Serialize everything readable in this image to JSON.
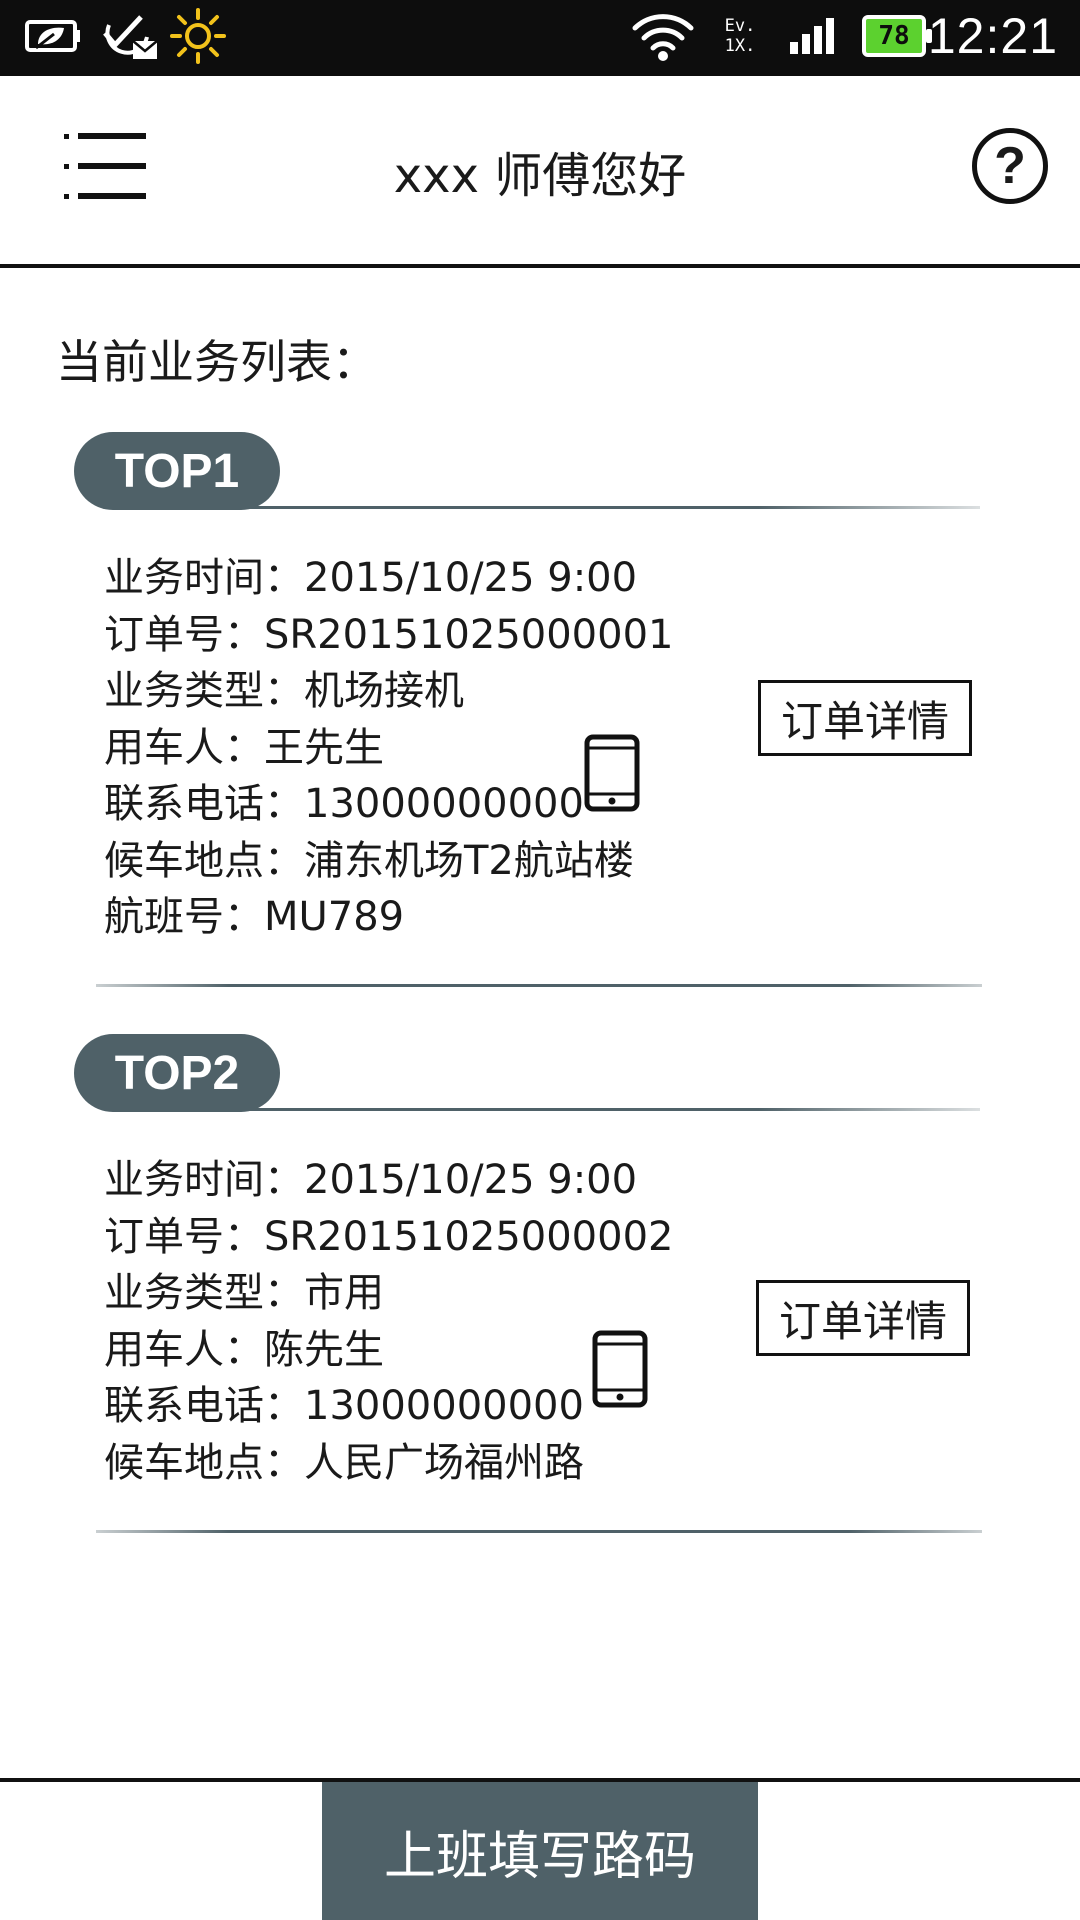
{
  "status_bar": {
    "network_top": "Ev.",
    "network_bottom": "1X.",
    "battery_level": "78",
    "time": "12:21",
    "icons": [
      "leaf-battery-icon",
      "mail-check-icon",
      "sun-icon",
      "wifi-icon",
      "ev-1x-network-icon",
      "cell-signal-icon",
      "battery-icon"
    ],
    "colors": {
      "background": "#0d0d0d",
      "battery_fill": "#5cd12f"
    }
  },
  "header": {
    "title": "xxx 师傅您好",
    "menu_icon": "menu-icon",
    "help_icon": "help-icon",
    "help_symbol": "?"
  },
  "main": {
    "list_title": "当前业务列表：",
    "orders": [
      {
        "badge": "TOP1",
        "lines": [
          "业务时间：2015/10/25  9:00",
          "订单号：SR20151025000001",
          "业务类型：机场接机",
          "用车人：王先生",
          "联系电话：13000000000",
          "候车地点：浦东机场T2航站楼",
          "航班号：MU789"
        ],
        "detail_label": "订单详情",
        "phone_icon": "phone-icon"
      },
      {
        "badge": "TOP2",
        "lines": [
          "业务时间：2015/10/25  9:00",
          "订单号：SR20151025000002",
          "业务类型：市用",
          "用车人：陈先生",
          "联系电话：13000000000",
          "候车地点：人民广场福州路"
        ],
        "detail_label": "订单详情",
        "phone_icon": "phone-icon"
      }
    ]
  },
  "bottom_bar": {
    "clock_in_label": "上班填写路码"
  },
  "colors": {
    "accent": "#4f6168",
    "text": "#1a1a1a",
    "background": "#ffffff"
  }
}
